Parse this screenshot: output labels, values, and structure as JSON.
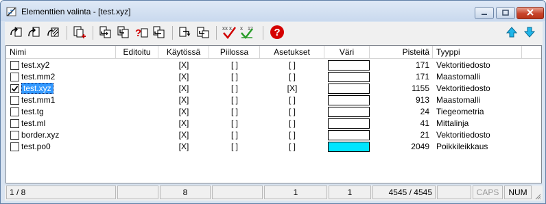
{
  "window": {
    "title": "Elementtien valinta - [test.xyz]",
    "close_color": "#c8442b"
  },
  "toolbar": {
    "buttons": [
      {
        "name": "open-element-button",
        "icon": "curved-arrow-page-icon"
      },
      {
        "name": "open-element-alt-button",
        "icon": "curved-arrow-page-icon"
      },
      {
        "name": "open-multiple-button",
        "icon": "striped-page-icon"
      },
      {
        "name": "add-element-button",
        "icon": "page-plus-icon"
      },
      {
        "name": "move-element-button",
        "icon": "page-arrow-icon"
      },
      {
        "name": "copy-element-button",
        "icon": "page-copy-icon"
      },
      {
        "name": "query-element-button",
        "icon": "question-page-icon"
      },
      {
        "name": "move-element-alt-button",
        "icon": "page-arrow-icon"
      },
      {
        "name": "export-element-button",
        "icon": "page-export-icon"
      },
      {
        "name": "export-element-alt-button",
        "icon": "page-export-icon"
      },
      {
        "name": "check-all-button",
        "icon": "check-mark-icon"
      },
      {
        "name": "numbered-check-button",
        "icon": "numbered-check-icon"
      },
      {
        "name": "help-button",
        "icon": "help-icon"
      },
      {
        "name": "move-up-button",
        "icon": "arrow-up-icon"
      },
      {
        "name": "move-down-button",
        "icon": "arrow-down-icon"
      }
    ],
    "help_glyph": "?",
    "numbered_check_label": "12",
    "accent_color": "#1fb5e9",
    "help_color": "#d50000"
  },
  "table": {
    "headers": [
      "Nimi",
      "Editoitu",
      "Käytössä",
      "Piilossa",
      "Asetukset",
      "Väri",
      "Pisteitä",
      "Tyyppi"
    ],
    "rows": [
      {
        "checked": false,
        "selected": false,
        "name": "test.xy2",
        "edited": "",
        "in_use": "[X]",
        "hidden": "[ ]",
        "settings": "[ ]",
        "color": "#ffffff",
        "points": "171",
        "type": "Vektoritiedosto"
      },
      {
        "checked": false,
        "selected": false,
        "name": "test.mm2",
        "edited": "",
        "in_use": "[X]",
        "hidden": "[ ]",
        "settings": "[ ]",
        "color": "#ffffff",
        "points": "171",
        "type": "Maastomalli"
      },
      {
        "checked": true,
        "selected": true,
        "name": "test.xyz",
        "edited": "",
        "in_use": "[X]",
        "hidden": "[ ]",
        "settings": "[X]",
        "color": "#ffffff",
        "points": "1155",
        "type": "Vektoritiedosto"
      },
      {
        "checked": false,
        "selected": false,
        "name": "test.mm1",
        "edited": "",
        "in_use": "[X]",
        "hidden": "[ ]",
        "settings": "[ ]",
        "color": "#ffffff",
        "points": "913",
        "type": "Maastomalli"
      },
      {
        "checked": false,
        "selected": false,
        "name": "test.tg",
        "edited": "",
        "in_use": "[X]",
        "hidden": "[ ]",
        "settings": "[ ]",
        "color": "#ffffff",
        "points": "24",
        "type": "Tiegeometria"
      },
      {
        "checked": false,
        "selected": false,
        "name": "test.ml",
        "edited": "",
        "in_use": "[X]",
        "hidden": "[ ]",
        "settings": "[ ]",
        "color": "#ffffff",
        "points": "41",
        "type": "Mittalinja"
      },
      {
        "checked": false,
        "selected": false,
        "name": "border.xyz",
        "edited": "",
        "in_use": "[X]",
        "hidden": "[ ]",
        "settings": "[ ]",
        "color": "#ffffff",
        "points": "21",
        "type": "Vektoritiedosto"
      },
      {
        "checked": false,
        "selected": false,
        "name": "test.po0",
        "edited": "",
        "in_use": "[X]",
        "hidden": "[ ]",
        "settings": "[ ]",
        "color": "#00e5ff",
        "points": "2049",
        "type": "Poikkileikkaus"
      }
    ],
    "selection_color": "#3399ff"
  },
  "status_bar": {
    "position": "1 / 8",
    "edited": "",
    "in_use": "8",
    "hidden": "",
    "settings": "1",
    "color": "1",
    "points": "4545 / 4545",
    "type": "",
    "caps": "CAPS",
    "num": "NUM"
  }
}
